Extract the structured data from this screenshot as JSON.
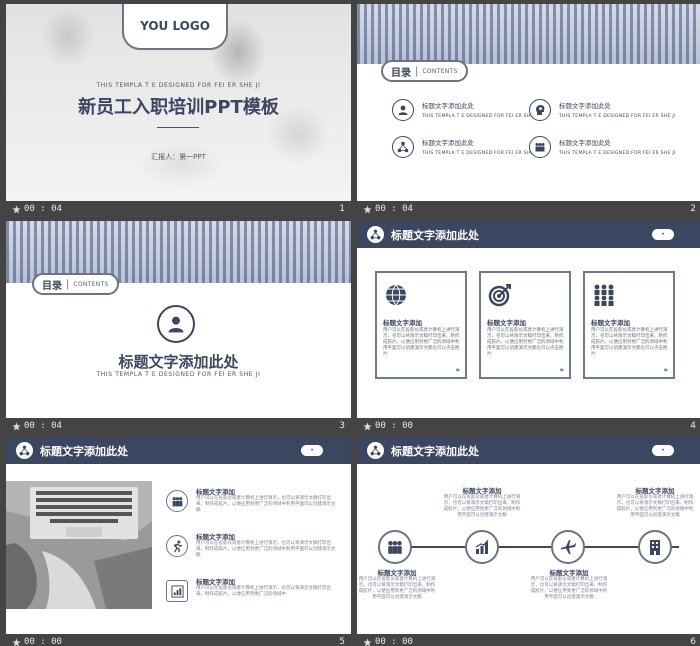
{
  "slides": [
    {
      "number": "1",
      "duration": "00 : 04",
      "logo": "YOU LOGO",
      "tagline": "THIS TEMPLA  T E DESIGNED  FOR FEI ER SHE JI",
      "title": "新员工入职培训PPT模板",
      "reporter": "汇报人：第一PPT"
    },
    {
      "number": "2",
      "duration": "00 : 04",
      "toc_label": "目录",
      "toc_en": "CONTENTS",
      "items": [
        {
          "title": "标题文字添加此处",
          "sub": "THIS TEMPLA T E DESIGNED FOR FEI ER SHE JI",
          "icon": "user-icon"
        },
        {
          "title": "标题文字添加此处",
          "sub": "THIS TEMPLA T E DESIGNED FOR FEI ER SHE JI",
          "icon": "head-gear-icon"
        },
        {
          "title": "标题文字添加此处",
          "sub": "THIS TEMPLA T E DESIGNED FOR FEI ER SHE JI",
          "icon": "network-icon"
        },
        {
          "title": "标题文字添加此处",
          "sub": "THIS TEMPLA T E DESIGNED FOR FEI ER SHE JI",
          "icon": "team-icon"
        }
      ]
    },
    {
      "number": "3",
      "duration": "00 : 04",
      "toc_label": "目录",
      "toc_en": "CONTENTS",
      "title": "标题文字添加此处",
      "tagline": "THIS TEMPLA  T E DESIGNED  FOR FEI ER SHE JI"
    },
    {
      "number": "4",
      "duration": "00 : 00",
      "header": "标题文字添加此处",
      "page_badge": "•",
      "boxes": [
        {
          "title": "标题文字添加",
          "body": "用户可以在投影仪或者计算机上进行演示，也可以将演示文稿打印出来，制作成胶片，以便应用到更广泛的领域中利用平面可以创建演示文稿也可以点击图片",
          "arrow": "»"
        },
        {
          "title": "标题文字添加",
          "body": "用户可以在投影仪或者计算机上进行演示，也可以将演示文稿打印出来，制作成胶片，以便应用到更广泛的领域中利用平面可以创建演示文稿也可以点击图片",
          "arrow": "»"
        },
        {
          "title": "标题文字添加",
          "body": "用户可以在投影仪或者计算机上进行演示，也可以将演示文稿打印出来，制作成胶片，以便应用到更广泛的领域中利用平面可以创建演示文稿也可以点击图片",
          "arrow": "»"
        }
      ]
    },
    {
      "number": "5",
      "duration": "00 : 00",
      "header": "标题文字添加此处",
      "page_badge": "•",
      "rows": [
        {
          "title": "标题文字添加",
          "body": "用户可以在投影仪或者计算机上进行演示，也可以将演示文稿打印出来，制作成胶片，以便应用到更广泛的领域中利用平面可以创建演示文稿"
        },
        {
          "title": "标题文字添加",
          "body": "用户可以在投影仪或者计算机上进行演示，也可以将演示文稿打印出来，制作成胶片，以便应用到更广泛的领域中利用平面可以创建演示文稿"
        },
        {
          "title": "标题文字添加",
          "body": "用户可以在投影仪或者计算机上进行演示，也可以将演示文稿打印出来，制作成胶片，以便应用到更广泛的领域中"
        }
      ]
    },
    {
      "number": "6",
      "duration": "00 : 00",
      "header": "标题文字添加此处",
      "page_badge": "•",
      "timeline": [
        {
          "title": "标题文字添加",
          "body": "用户可以在投影仪或者计算机上进行演示，也可以将演示文稿打印出来，制作成胶片，以便应用到更广泛的领域中利用平面可以创建演示文稿"
        },
        {
          "title": "标题文字添加",
          "body": "用户可以在投影仪或者计算机上进行演示，也可以将演示文稿打印出来，制作成胶片，以便应用到更广泛的领域中利用平面可以创建演示文稿"
        },
        {
          "title": "标题文字添加",
          "body": "用户可以在投影仪或者计算机上进行演示，也可以将演示文稿打印出来，制作成胶片，以便应用到更广泛的领域中利用平面可以创建演示文稿"
        },
        {
          "title": "标题文字添加",
          "body": "用户可以在投影仪或者计算机上进行演示，也可以将演示文稿打印出来，制作成胶片，以便应用到更广泛的领域中利用平面可以创建演示文稿"
        }
      ]
    }
  ]
}
